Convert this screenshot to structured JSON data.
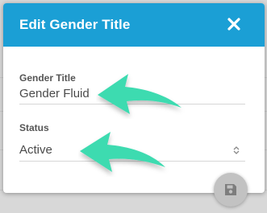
{
  "modal": {
    "title": "Edit Gender Title",
    "close_icon": "close-icon",
    "header_color": "#1b9fd5"
  },
  "fields": {
    "gender_title": {
      "label": "Gender Title",
      "value": "Gender Fluid"
    },
    "status": {
      "label": "Status",
      "value": "Active",
      "caret_icon": "sort-caret-icon"
    }
  },
  "annotations": {
    "arrow_color": "#3ddbb0",
    "arrow_icon": "curved-arrow-icon"
  },
  "actions": {
    "save_icon": "floppy-disk-icon",
    "save_color": "#c2c2c2"
  }
}
